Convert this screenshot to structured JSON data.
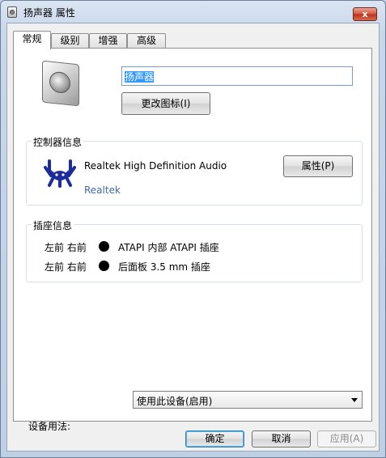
{
  "window": {
    "title": "扬声器 属性",
    "close_glyph": "x"
  },
  "tabs": [
    "常规",
    "级别",
    "增强",
    "高级"
  ],
  "general": {
    "device_name": "扬声器",
    "change_icon_label": "更改图标(I)"
  },
  "controller": {
    "group_label": "控制器信息",
    "name": "Realtek High Definition Audio",
    "vendor": "Realtek",
    "properties_label": "属性(P)",
    "logo_icon": "realtek-crab-icon",
    "logo_color": "#1d2c9c",
    "vendor_color": "#3f6aa5"
  },
  "jacks": {
    "group_label": "插座信息",
    "items": [
      {
        "position": "左前 右前",
        "description": "ATAPI 内部 ATAPI 插座",
        "color": "#000000"
      },
      {
        "position": "左前 右前",
        "description": "后面板 3.5 mm 插座",
        "color": "#000000"
      }
    ]
  },
  "usage": {
    "label": "设备用法:",
    "selected": "使用此设备(启用)"
  },
  "footer": {
    "ok_label": "确定",
    "cancel_label": "取消",
    "apply_label": "应用(A)"
  }
}
